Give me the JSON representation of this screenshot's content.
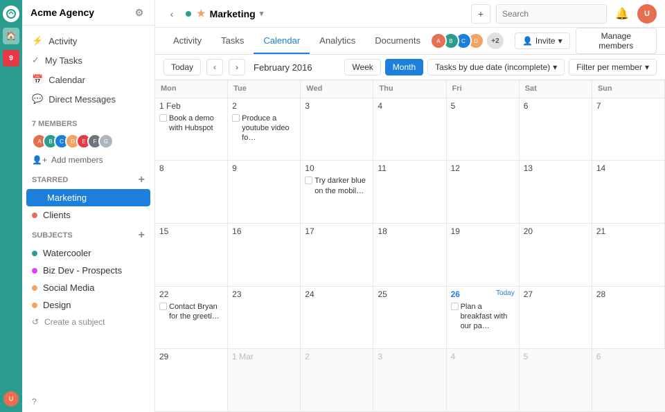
{
  "app": {
    "name": "Acme Agency"
  },
  "topbar": {
    "current_space": "Marketing",
    "chevron": "▾",
    "search_placeholder": "Search"
  },
  "sidebar": {
    "nav_items": [
      {
        "id": "activity",
        "label": "Activity",
        "icon": "⚡"
      },
      {
        "id": "my-tasks",
        "label": "My Tasks",
        "icon": "✓"
      },
      {
        "id": "calendar",
        "label": "Calendar",
        "icon": "📅"
      },
      {
        "id": "direct-messages",
        "label": "Direct Messages",
        "icon": "💬"
      }
    ],
    "members_label": "7 MEMBERS",
    "add_members_label": "Add members",
    "starred_label": "STARRED",
    "starred_items": [
      {
        "id": "marketing",
        "label": "Marketing",
        "color": "#1d7fdc",
        "active": true
      },
      {
        "id": "clients",
        "label": "Clients",
        "color": "#e76f51",
        "active": false
      }
    ],
    "subjects_label": "SUBJECTS",
    "subjects": [
      {
        "id": "watercooler",
        "label": "Watercooler",
        "color": "#2a9d8f"
      },
      {
        "id": "biz-dev",
        "label": "Biz Dev - Prospects",
        "color": "#e040fb"
      },
      {
        "id": "social-media",
        "label": "Social Media",
        "color": "#f4a261"
      },
      {
        "id": "design",
        "label": "Design",
        "color": "#f4a261"
      }
    ],
    "create_subject_label": "Create a subject",
    "help_label": "?"
  },
  "tabs": [
    {
      "id": "activity",
      "label": "Activity"
    },
    {
      "id": "tasks",
      "label": "Tasks"
    },
    {
      "id": "calendar",
      "label": "Calendar",
      "active": true
    },
    {
      "id": "analytics",
      "label": "Analytics"
    },
    {
      "id": "documents",
      "label": "Documents"
    }
  ],
  "member_avatars": [
    {
      "color": "#e76f51",
      "initials": "A"
    },
    {
      "color": "#2a9d8f",
      "initials": "B"
    },
    {
      "color": "#1d7fdc",
      "initials": "C"
    },
    {
      "color": "#f4a261",
      "initials": "D"
    }
  ],
  "plus_count": "+2",
  "invite_label": "Invite",
  "manage_members_label": "Manage members",
  "calendar": {
    "today_label": "Today",
    "month_label": "February 2016",
    "week_label": "Week",
    "month_btn_label": "Month",
    "tasks_filter_label": "Tasks by due date (incomplete)",
    "filter_per_member_label": "Filter per member",
    "day_headers": [
      "Mon",
      "Tue",
      "Wed",
      "Thu",
      "Fri",
      "Sat",
      "Sun"
    ],
    "weeks": [
      [
        {
          "num": "1 Feb",
          "tasks": [
            "Book a demo with Hubspot"
          ],
          "other": false,
          "today": false
        },
        {
          "num": "2",
          "tasks": [
            "Produce a youtube video fo…"
          ],
          "other": false,
          "today": false
        },
        {
          "num": "3",
          "tasks": [],
          "other": false,
          "today": false
        },
        {
          "num": "4",
          "tasks": [],
          "other": false,
          "today": false
        },
        {
          "num": "5",
          "tasks": [],
          "other": false,
          "today": false
        },
        {
          "num": "6",
          "tasks": [],
          "other": false,
          "today": false
        },
        {
          "num": "7",
          "tasks": [],
          "other": false,
          "today": false
        }
      ],
      [
        {
          "num": "8",
          "tasks": [],
          "other": false,
          "today": false
        },
        {
          "num": "9",
          "tasks": [],
          "other": false,
          "today": false
        },
        {
          "num": "10",
          "tasks": [
            "Try darker blue on the mobil…"
          ],
          "other": false,
          "today": false
        },
        {
          "num": "11",
          "tasks": [],
          "other": false,
          "today": false
        },
        {
          "num": "12",
          "tasks": [],
          "other": false,
          "today": false
        },
        {
          "num": "13",
          "tasks": [],
          "other": false,
          "today": false
        },
        {
          "num": "14",
          "tasks": [],
          "other": false,
          "today": false
        }
      ],
      [
        {
          "num": "15",
          "tasks": [],
          "other": false,
          "today": false
        },
        {
          "num": "16",
          "tasks": [],
          "other": false,
          "today": false
        },
        {
          "num": "17",
          "tasks": [],
          "other": false,
          "today": false
        },
        {
          "num": "18",
          "tasks": [],
          "other": false,
          "today": false
        },
        {
          "num": "19",
          "tasks": [],
          "other": false,
          "today": false
        },
        {
          "num": "20",
          "tasks": [],
          "other": false,
          "today": false
        },
        {
          "num": "21",
          "tasks": [],
          "other": false,
          "today": false
        }
      ],
      [
        {
          "num": "22",
          "tasks": [
            "Contact Bryan for the greeti…"
          ],
          "other": false,
          "today": false
        },
        {
          "num": "23",
          "tasks": [],
          "other": false,
          "today": false
        },
        {
          "num": "24",
          "tasks": [],
          "other": false,
          "today": false
        },
        {
          "num": "25",
          "tasks": [],
          "other": false,
          "today": false
        },
        {
          "num": "26",
          "tasks": [
            "Plan a breakfast with our pa…"
          ],
          "other": false,
          "today": true
        },
        {
          "num": "27",
          "tasks": [],
          "other": false,
          "today": false
        },
        {
          "num": "28",
          "tasks": [],
          "other": false,
          "today": false
        }
      ],
      [
        {
          "num": "29",
          "tasks": [],
          "other": false,
          "today": false
        },
        {
          "num": "1 Mar",
          "tasks": [],
          "other": true,
          "today": false
        },
        {
          "num": "2",
          "tasks": [],
          "other": true,
          "today": false
        },
        {
          "num": "3",
          "tasks": [],
          "other": true,
          "today": false
        },
        {
          "num": "4",
          "tasks": [],
          "other": true,
          "today": false
        },
        {
          "num": "5",
          "tasks": [],
          "other": true,
          "today": false
        },
        {
          "num": "6",
          "tasks": [],
          "other": true,
          "today": false
        }
      ]
    ]
  }
}
